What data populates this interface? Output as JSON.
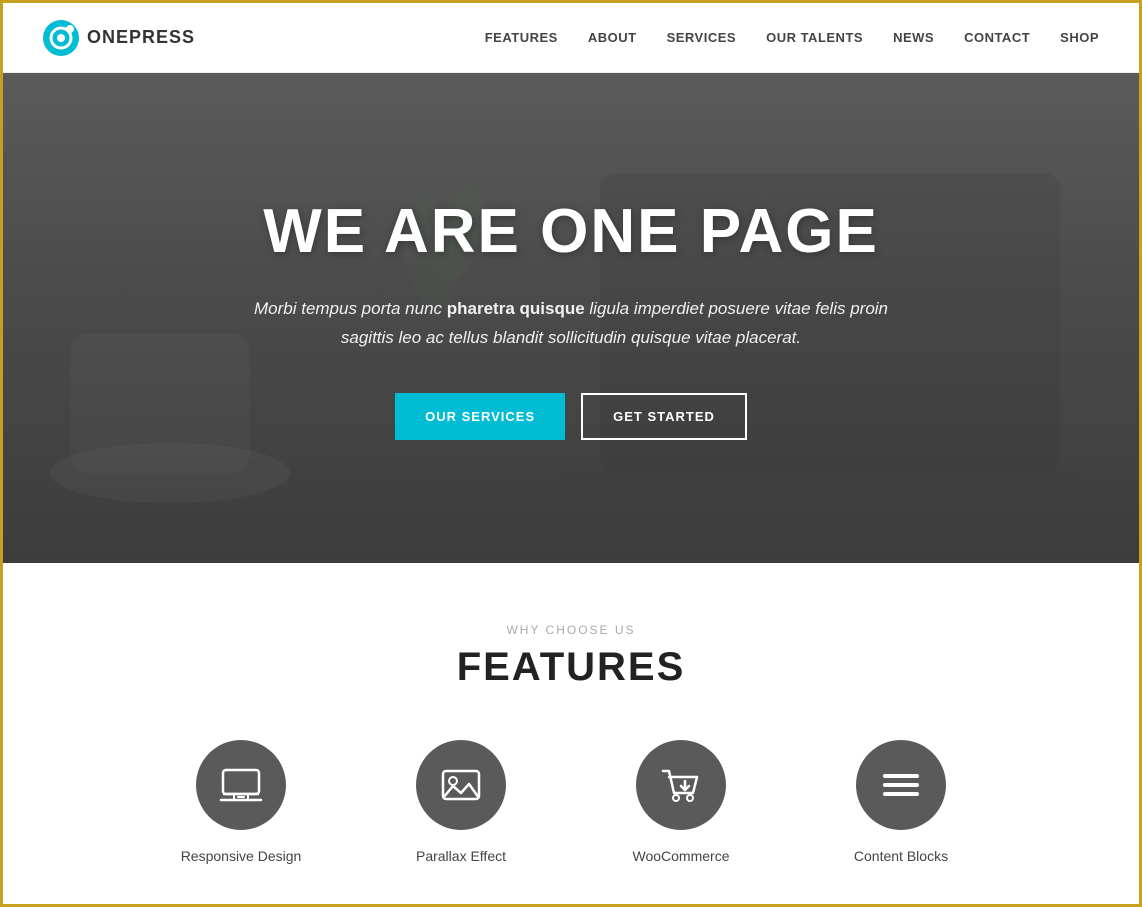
{
  "brand": {
    "name": "ONEPRESS"
  },
  "nav": {
    "items": [
      {
        "label": "FEATURES",
        "href": "#features"
      },
      {
        "label": "ABOUT",
        "href": "#about"
      },
      {
        "label": "SERVICES",
        "href": "#services"
      },
      {
        "label": "OUR TALENTS",
        "href": "#talents"
      },
      {
        "label": "NEWS",
        "href": "#news"
      },
      {
        "label": "CONTACT",
        "href": "#contact"
      },
      {
        "label": "SHOP",
        "href": "#shop"
      }
    ]
  },
  "hero": {
    "title": "WE ARE ONE PAGE",
    "subtitle_plain": "Morbi tempus porta nunc ",
    "subtitle_bold": "pharetra quisque",
    "subtitle_end": " ligula imperdiet posuere vitae felis proin sagittis leo ac tellus blandit sollicitudin quisque vitae placerat.",
    "btn_primary": "OUR SERVICES",
    "btn_secondary": "GET STARTED"
  },
  "features": {
    "subtitle": "WHY CHOOSE US",
    "title": "FEATURES",
    "items": [
      {
        "label": "Responsive Design",
        "icon": "laptop"
      },
      {
        "label": "Parallax Effect",
        "icon": "image"
      },
      {
        "label": "WooCommerce",
        "icon": "cart"
      },
      {
        "label": "Content Blocks",
        "icon": "menu"
      }
    ]
  },
  "colors": {
    "accent": "#00bcd4",
    "icon_bg": "#5a5a5a"
  }
}
